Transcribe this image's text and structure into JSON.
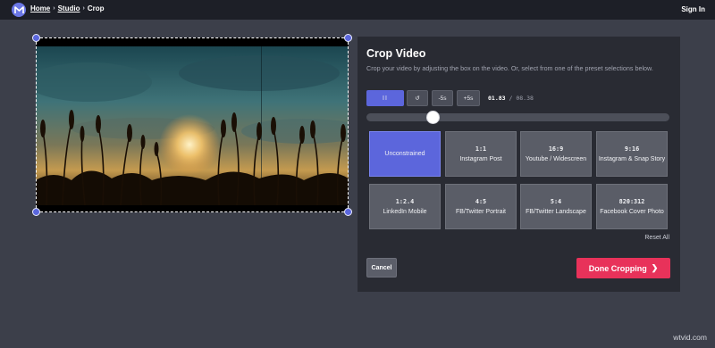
{
  "header": {
    "breadcrumb": [
      {
        "label": "Home"
      },
      {
        "label": "Studio"
      },
      {
        "label": "Crop"
      }
    ],
    "separator": "›",
    "signin_label": "Sign In",
    "logo_icon": "studio-logo-icon"
  },
  "video": {
    "description_icon": "video-preview"
  },
  "panel": {
    "title": "Crop Video",
    "description": "Crop your video by adjusting the box on the video. Or, select from one of the preset selections below.",
    "controls": {
      "play_pause_icon": "pause-icon",
      "play_pause_label": "II",
      "restart_icon": "restart-icon",
      "restart_label": "↺",
      "back_label": "-5s",
      "forward_label": "+5s"
    },
    "time": {
      "current": "01.83",
      "separator": " / ",
      "total": "08.38"
    },
    "presets": [
      {
        "ratio": "",
        "label": "Unconstrained",
        "active": true
      },
      {
        "ratio": "1:1",
        "label": "Instagram Post"
      },
      {
        "ratio": "16:9",
        "label": "Youtube / Widescreen"
      },
      {
        "ratio": "9:16",
        "label": "Instagram & Snap Story"
      },
      {
        "ratio": "1:2.4",
        "label": "LinkedIn Mobile"
      },
      {
        "ratio": "4:5",
        "label": "FB/Twitter Portrait"
      },
      {
        "ratio": "5:4",
        "label": "FB/Twitter Landscape"
      },
      {
        "ratio": "820:312",
        "label": "Facebook Cover Photo"
      }
    ],
    "reset_label": "Reset All",
    "cancel_label": "Cancel",
    "done_label": "Done Cropping",
    "done_icon": "chevron-right-icon",
    "done_arrow": "❯"
  },
  "watermark": "wtvid.com",
  "colors": {
    "accent": "#5c66dc",
    "done": "#e8325a",
    "background": "#3c3f4a",
    "panel": "#292b33",
    "topbar": "#1d1f27"
  }
}
